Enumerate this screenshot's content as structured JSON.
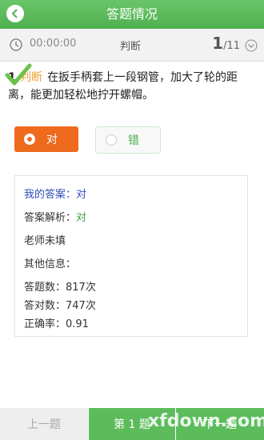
{
  "header": {
    "title": "答题情况"
  },
  "infobar": {
    "timer": "00:00:00",
    "question_type": "判断",
    "current": "1",
    "total": "/11"
  },
  "question": {
    "number": "1.",
    "tag": "判断",
    "text": "在扳手柄套上一段钢管，加大了轮的距离，能更加轻松地拧开螺帽。"
  },
  "options": {
    "true_label": "对",
    "false_label": "错"
  },
  "result": {
    "my_answer_label": "我的答案：",
    "my_answer_value": "对",
    "analysis_label": "答案解析：",
    "analysis_value": "对",
    "teacher_note": "老师未填",
    "other_info_label": "其他信息：",
    "answer_count": "答题数：817次",
    "correct_count": "答对数：747次",
    "accuracy": "正确率：0.91"
  },
  "bottom": {
    "prev": "上一题",
    "current": "第 1 题",
    "next": "下一题"
  },
  "watermark": "xfdown.com"
}
